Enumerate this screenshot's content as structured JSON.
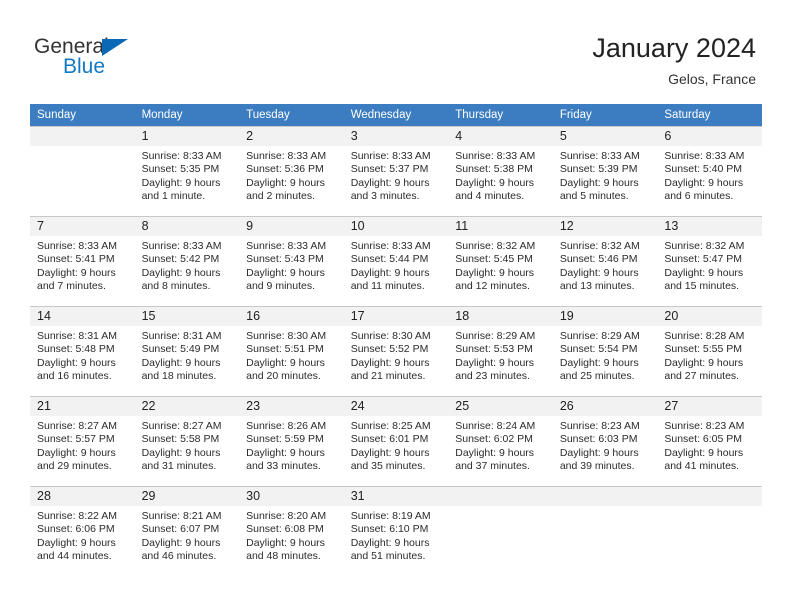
{
  "brand": {
    "line1": "General",
    "line2": "Blue",
    "triangle_color": "#0a68b4",
    "blue_text_color": "#1479c4"
  },
  "header": {
    "title": "January 2024",
    "subtitle": "Gelos, France"
  },
  "theme": {
    "header_row_bg": "#3b7dc0",
    "daynum_bg": "#f2f2f2",
    "grid_line": "#c8c8c8"
  },
  "weekdays": [
    "Sunday",
    "Monday",
    "Tuesday",
    "Wednesday",
    "Thursday",
    "Friday",
    "Saturday"
  ],
  "weeks": [
    [
      {
        "day": "",
        "sunrise": "",
        "sunset": "",
        "daylight1": "",
        "daylight2": ""
      },
      {
        "day": "1",
        "sunrise": "Sunrise: 8:33 AM",
        "sunset": "Sunset: 5:35 PM",
        "daylight1": "Daylight: 9 hours",
        "daylight2": "and 1 minute."
      },
      {
        "day": "2",
        "sunrise": "Sunrise: 8:33 AM",
        "sunset": "Sunset: 5:36 PM",
        "daylight1": "Daylight: 9 hours",
        "daylight2": "and 2 minutes."
      },
      {
        "day": "3",
        "sunrise": "Sunrise: 8:33 AM",
        "sunset": "Sunset: 5:37 PM",
        "daylight1": "Daylight: 9 hours",
        "daylight2": "and 3 minutes."
      },
      {
        "day": "4",
        "sunrise": "Sunrise: 8:33 AM",
        "sunset": "Sunset: 5:38 PM",
        "daylight1": "Daylight: 9 hours",
        "daylight2": "and 4 minutes."
      },
      {
        "day": "5",
        "sunrise": "Sunrise: 8:33 AM",
        "sunset": "Sunset: 5:39 PM",
        "daylight1": "Daylight: 9 hours",
        "daylight2": "and 5 minutes."
      },
      {
        "day": "6",
        "sunrise": "Sunrise: 8:33 AM",
        "sunset": "Sunset: 5:40 PM",
        "daylight1": "Daylight: 9 hours",
        "daylight2": "and 6 minutes."
      }
    ],
    [
      {
        "day": "7",
        "sunrise": "Sunrise: 8:33 AM",
        "sunset": "Sunset: 5:41 PM",
        "daylight1": "Daylight: 9 hours",
        "daylight2": "and 7 minutes."
      },
      {
        "day": "8",
        "sunrise": "Sunrise: 8:33 AM",
        "sunset": "Sunset: 5:42 PM",
        "daylight1": "Daylight: 9 hours",
        "daylight2": "and 8 minutes."
      },
      {
        "day": "9",
        "sunrise": "Sunrise: 8:33 AM",
        "sunset": "Sunset: 5:43 PM",
        "daylight1": "Daylight: 9 hours",
        "daylight2": "and 9 minutes."
      },
      {
        "day": "10",
        "sunrise": "Sunrise: 8:33 AM",
        "sunset": "Sunset: 5:44 PM",
        "daylight1": "Daylight: 9 hours",
        "daylight2": "and 11 minutes."
      },
      {
        "day": "11",
        "sunrise": "Sunrise: 8:32 AM",
        "sunset": "Sunset: 5:45 PM",
        "daylight1": "Daylight: 9 hours",
        "daylight2": "and 12 minutes."
      },
      {
        "day": "12",
        "sunrise": "Sunrise: 8:32 AM",
        "sunset": "Sunset: 5:46 PM",
        "daylight1": "Daylight: 9 hours",
        "daylight2": "and 13 minutes."
      },
      {
        "day": "13",
        "sunrise": "Sunrise: 8:32 AM",
        "sunset": "Sunset: 5:47 PM",
        "daylight1": "Daylight: 9 hours",
        "daylight2": "and 15 minutes."
      }
    ],
    [
      {
        "day": "14",
        "sunrise": "Sunrise: 8:31 AM",
        "sunset": "Sunset: 5:48 PM",
        "daylight1": "Daylight: 9 hours",
        "daylight2": "and 16 minutes."
      },
      {
        "day": "15",
        "sunrise": "Sunrise: 8:31 AM",
        "sunset": "Sunset: 5:49 PM",
        "daylight1": "Daylight: 9 hours",
        "daylight2": "and 18 minutes."
      },
      {
        "day": "16",
        "sunrise": "Sunrise: 8:30 AM",
        "sunset": "Sunset: 5:51 PM",
        "daylight1": "Daylight: 9 hours",
        "daylight2": "and 20 minutes."
      },
      {
        "day": "17",
        "sunrise": "Sunrise: 8:30 AM",
        "sunset": "Sunset: 5:52 PM",
        "daylight1": "Daylight: 9 hours",
        "daylight2": "and 21 minutes."
      },
      {
        "day": "18",
        "sunrise": "Sunrise: 8:29 AM",
        "sunset": "Sunset: 5:53 PM",
        "daylight1": "Daylight: 9 hours",
        "daylight2": "and 23 minutes."
      },
      {
        "day": "19",
        "sunrise": "Sunrise: 8:29 AM",
        "sunset": "Sunset: 5:54 PM",
        "daylight1": "Daylight: 9 hours",
        "daylight2": "and 25 minutes."
      },
      {
        "day": "20",
        "sunrise": "Sunrise: 8:28 AM",
        "sunset": "Sunset: 5:55 PM",
        "daylight1": "Daylight: 9 hours",
        "daylight2": "and 27 minutes."
      }
    ],
    [
      {
        "day": "21",
        "sunrise": "Sunrise: 8:27 AM",
        "sunset": "Sunset: 5:57 PM",
        "daylight1": "Daylight: 9 hours",
        "daylight2": "and 29 minutes."
      },
      {
        "day": "22",
        "sunrise": "Sunrise: 8:27 AM",
        "sunset": "Sunset: 5:58 PM",
        "daylight1": "Daylight: 9 hours",
        "daylight2": "and 31 minutes."
      },
      {
        "day": "23",
        "sunrise": "Sunrise: 8:26 AM",
        "sunset": "Sunset: 5:59 PM",
        "daylight1": "Daylight: 9 hours",
        "daylight2": "and 33 minutes."
      },
      {
        "day": "24",
        "sunrise": "Sunrise: 8:25 AM",
        "sunset": "Sunset: 6:01 PM",
        "daylight1": "Daylight: 9 hours",
        "daylight2": "and 35 minutes."
      },
      {
        "day": "25",
        "sunrise": "Sunrise: 8:24 AM",
        "sunset": "Sunset: 6:02 PM",
        "daylight1": "Daylight: 9 hours",
        "daylight2": "and 37 minutes."
      },
      {
        "day": "26",
        "sunrise": "Sunrise: 8:23 AM",
        "sunset": "Sunset: 6:03 PM",
        "daylight1": "Daylight: 9 hours",
        "daylight2": "and 39 minutes."
      },
      {
        "day": "27",
        "sunrise": "Sunrise: 8:23 AM",
        "sunset": "Sunset: 6:05 PM",
        "daylight1": "Daylight: 9 hours",
        "daylight2": "and 41 minutes."
      }
    ],
    [
      {
        "day": "28",
        "sunrise": "Sunrise: 8:22 AM",
        "sunset": "Sunset: 6:06 PM",
        "daylight1": "Daylight: 9 hours",
        "daylight2": "and 44 minutes."
      },
      {
        "day": "29",
        "sunrise": "Sunrise: 8:21 AM",
        "sunset": "Sunset: 6:07 PM",
        "daylight1": "Daylight: 9 hours",
        "daylight2": "and 46 minutes."
      },
      {
        "day": "30",
        "sunrise": "Sunrise: 8:20 AM",
        "sunset": "Sunset: 6:08 PM",
        "daylight1": "Daylight: 9 hours",
        "daylight2": "and 48 minutes."
      },
      {
        "day": "31",
        "sunrise": "Sunrise: 8:19 AM",
        "sunset": "Sunset: 6:10 PM",
        "daylight1": "Daylight: 9 hours",
        "daylight2": "and 51 minutes."
      },
      {
        "day": "",
        "sunrise": "",
        "sunset": "",
        "daylight1": "",
        "daylight2": ""
      },
      {
        "day": "",
        "sunrise": "",
        "sunset": "",
        "daylight1": "",
        "daylight2": ""
      },
      {
        "day": "",
        "sunrise": "",
        "sunset": "",
        "daylight1": "",
        "daylight2": ""
      }
    ]
  ]
}
